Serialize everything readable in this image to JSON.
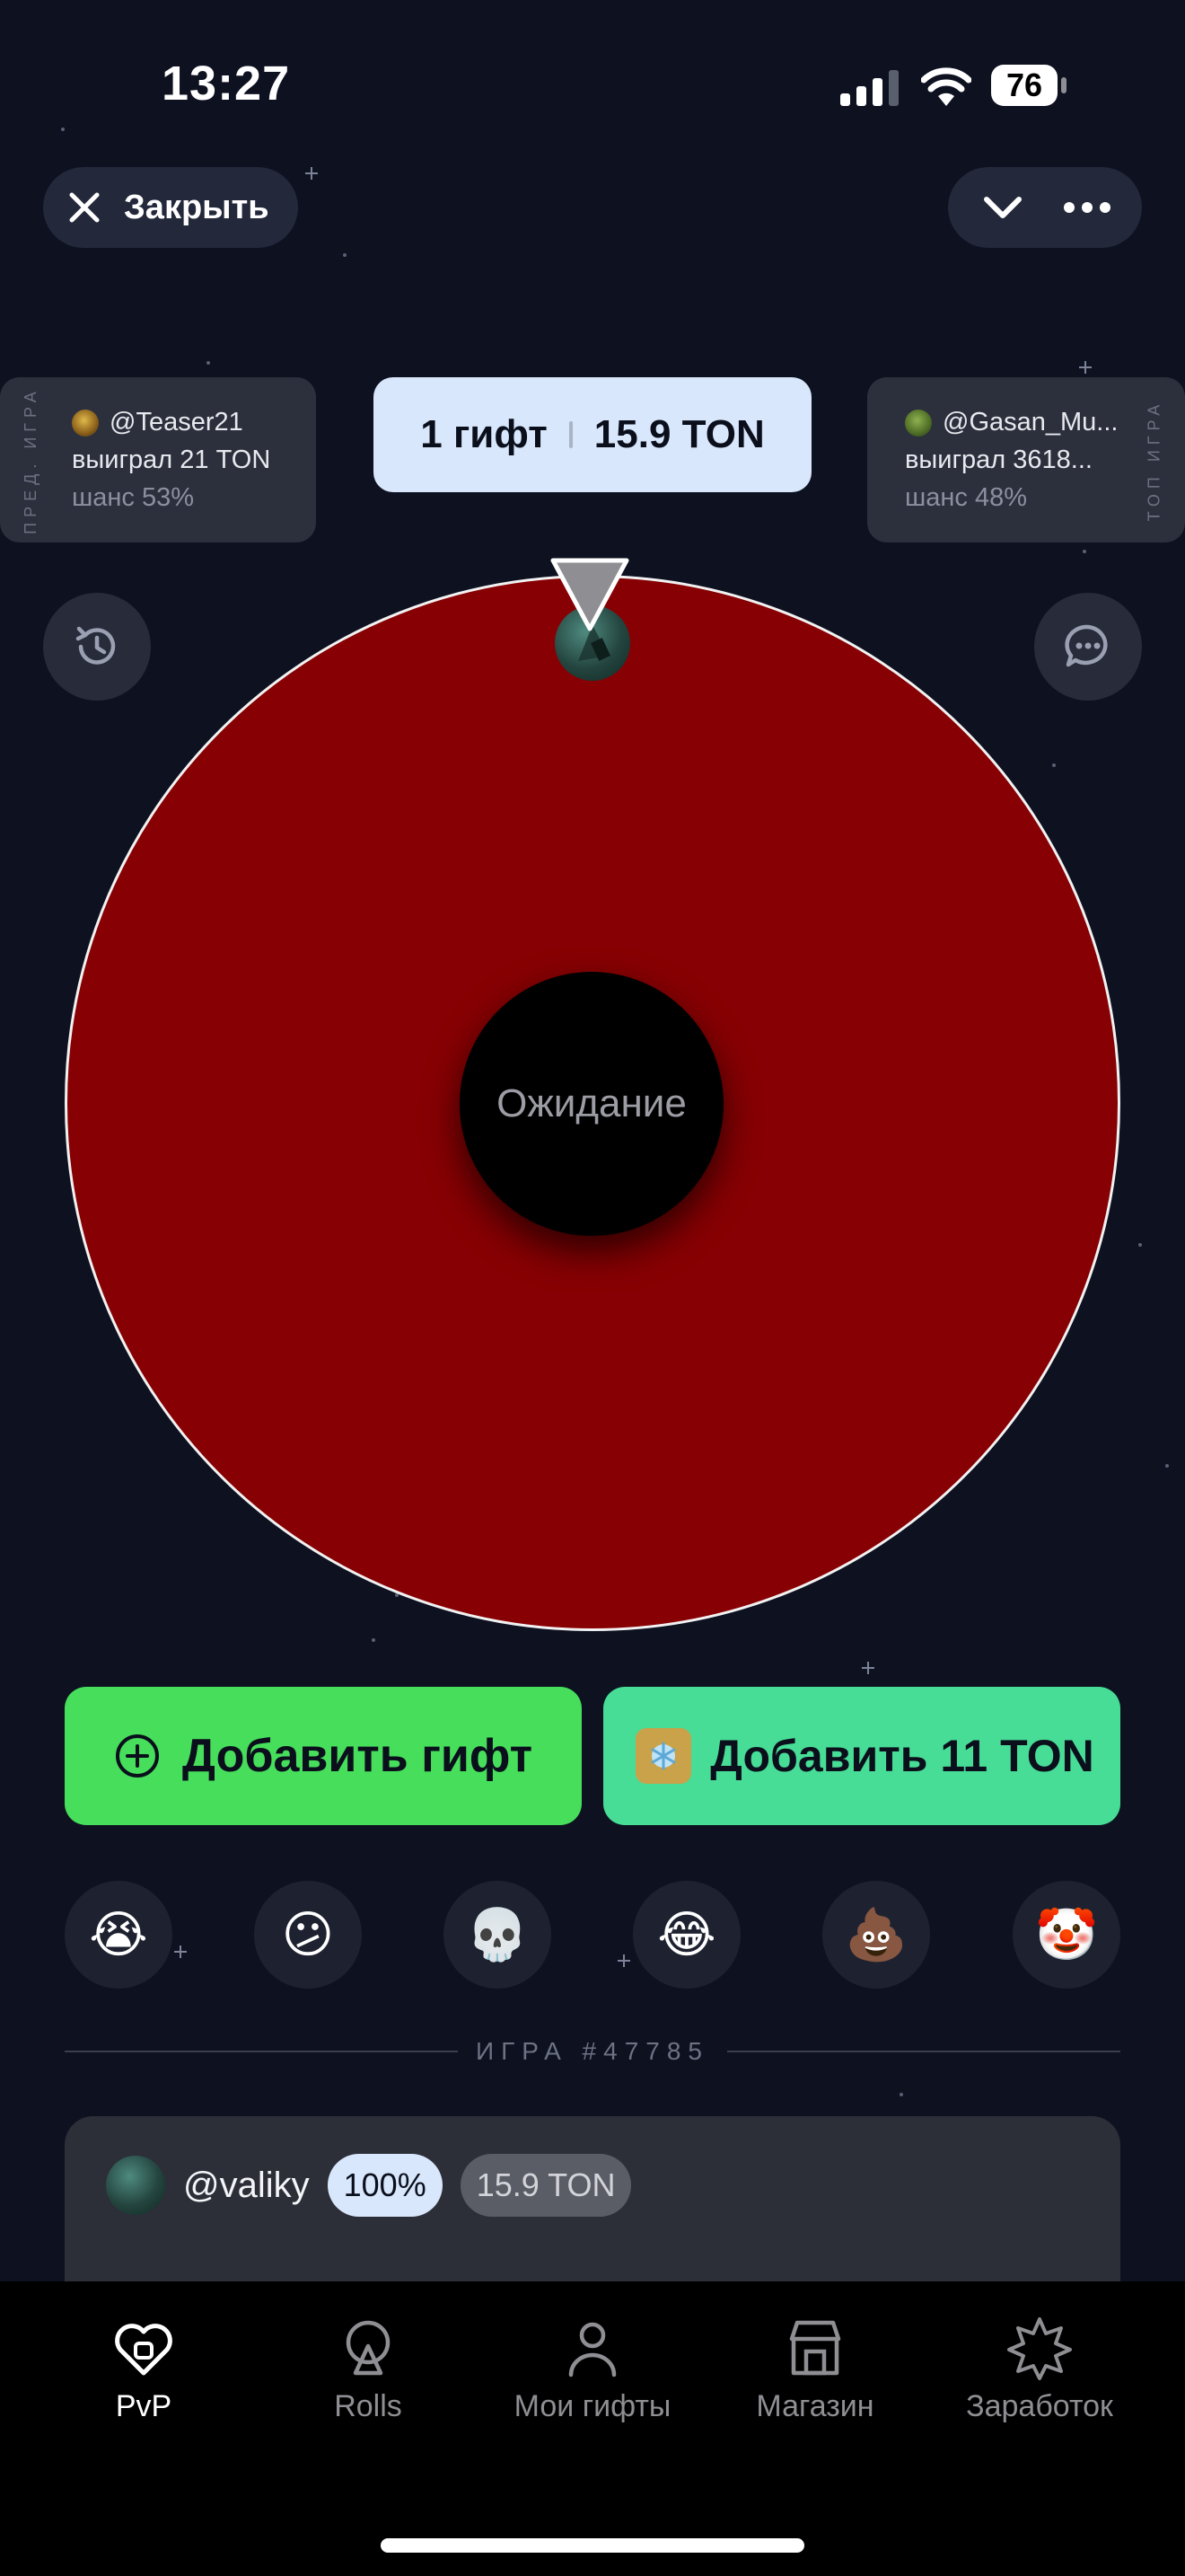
{
  "status_bar": {
    "time": "13:27",
    "battery": "76"
  },
  "header": {
    "close_label": "Закрыть"
  },
  "prev_game": {
    "vertical_label": "ПРЕД. ИГРА",
    "user": "@Teaser21",
    "result": "выиграл 21 TON",
    "chance": "шанс 53%"
  },
  "top_game": {
    "vertical_label": "ТОП ИГРА",
    "user": "@Gasan_Mu...",
    "result": "выиграл 3618...",
    "chance": "шанс 48%"
  },
  "summary": {
    "gifts": "1 гифт",
    "total": "15.9 TON"
  },
  "wheel": {
    "status": "Ожидание",
    "segment_color": "#870003"
  },
  "actions": {
    "add_gift": "Добавить гифт",
    "add_ton": "Добавить 11 TON"
  },
  "reactions": [
    "😭",
    "😕",
    "💀",
    "😂",
    "💩",
    "🤡"
  ],
  "game": {
    "label": "ИГРА  #47785"
  },
  "participant": {
    "user": "@valiky",
    "chance": "100%",
    "amount": "15.9 TON"
  },
  "tabs": [
    {
      "label": "PvP",
      "icon": "heart-icon",
      "active": true
    },
    {
      "label": "Rolls",
      "icon": "roulette-icon",
      "active": false
    },
    {
      "label": "Мои гифты",
      "icon": "person-icon",
      "active": false
    },
    {
      "label": "Магазин",
      "icon": "store-icon",
      "active": false
    },
    {
      "label": "Заработок",
      "icon": "star-badge-icon",
      "active": false
    }
  ],
  "colors": {
    "background": "#0d1120",
    "accent_green": "#46de5b",
    "accent_teal": "#47dd96",
    "pill_blue": "#d8e7fb"
  }
}
